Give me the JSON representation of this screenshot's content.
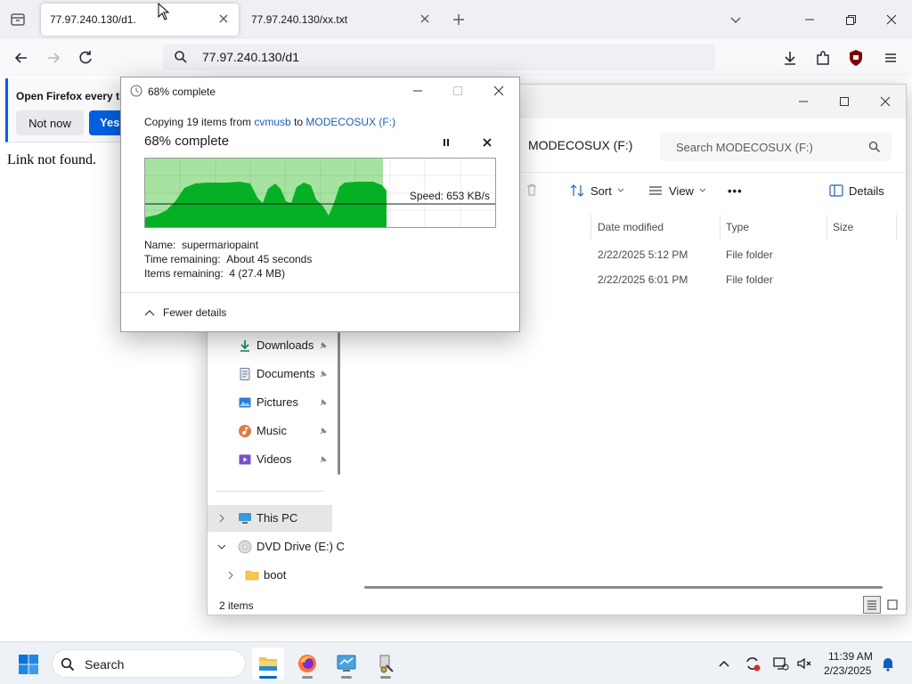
{
  "browser": {
    "tabs": [
      {
        "title": "77.97.240.130/d1.",
        "active": true
      },
      {
        "title": "77.97.240.130/xx.txt",
        "active": false
      }
    ],
    "url": "77.97.240.130/d1",
    "notification": {
      "text": "Open Firefox every ti",
      "not_now": "Not now",
      "yes": "Yes, c"
    },
    "page_text": "Link not found."
  },
  "explorer": {
    "location": "MODECOSUX (F:)",
    "search_placeholder": "Search MODECOSUX (F:)",
    "toolbar": {
      "sort": "Sort",
      "view": "View",
      "more": "•••",
      "details": "Details"
    },
    "columns": {
      "date_modified": "Date modified",
      "type": "Type",
      "size": "Size"
    },
    "rows": [
      {
        "date": "2/22/2025 5:12 PM",
        "type": "File folder"
      },
      {
        "date": "2/22/2025 6:01 PM",
        "type": "File folder"
      }
    ],
    "nav": {
      "downloads": "Downloads",
      "documents": "Documents",
      "pictures": "Pictures",
      "music": "Music",
      "videos": "Videos",
      "this_pc": "This PC",
      "dvd": "DVD Drive (E:) C",
      "boot": "boot"
    },
    "status": "2 items"
  },
  "copy_dialog": {
    "title": "68% complete",
    "copying_prefix": "Copying 19 items from ",
    "source": "cvmusb",
    "to_word": " to ",
    "destination": "MODECOSUX (F:)",
    "heading": "68% complete",
    "progress": 0.68,
    "speed": "Speed: 653 KB/s",
    "name_label": "Name:",
    "name_value": "supermariopaint",
    "time_label": "Time remaining:",
    "time_value": "About 45 seconds",
    "items_label": "Items remaining:",
    "items_value": "4 (27.4 MB)",
    "fewer_details": "Fewer details",
    "colors": {
      "done_fill": "#a6e3a1",
      "graph": "#06b025"
    }
  },
  "taskbar": {
    "search": "Search",
    "time": "11:39 AM",
    "date": "2/23/2025"
  }
}
